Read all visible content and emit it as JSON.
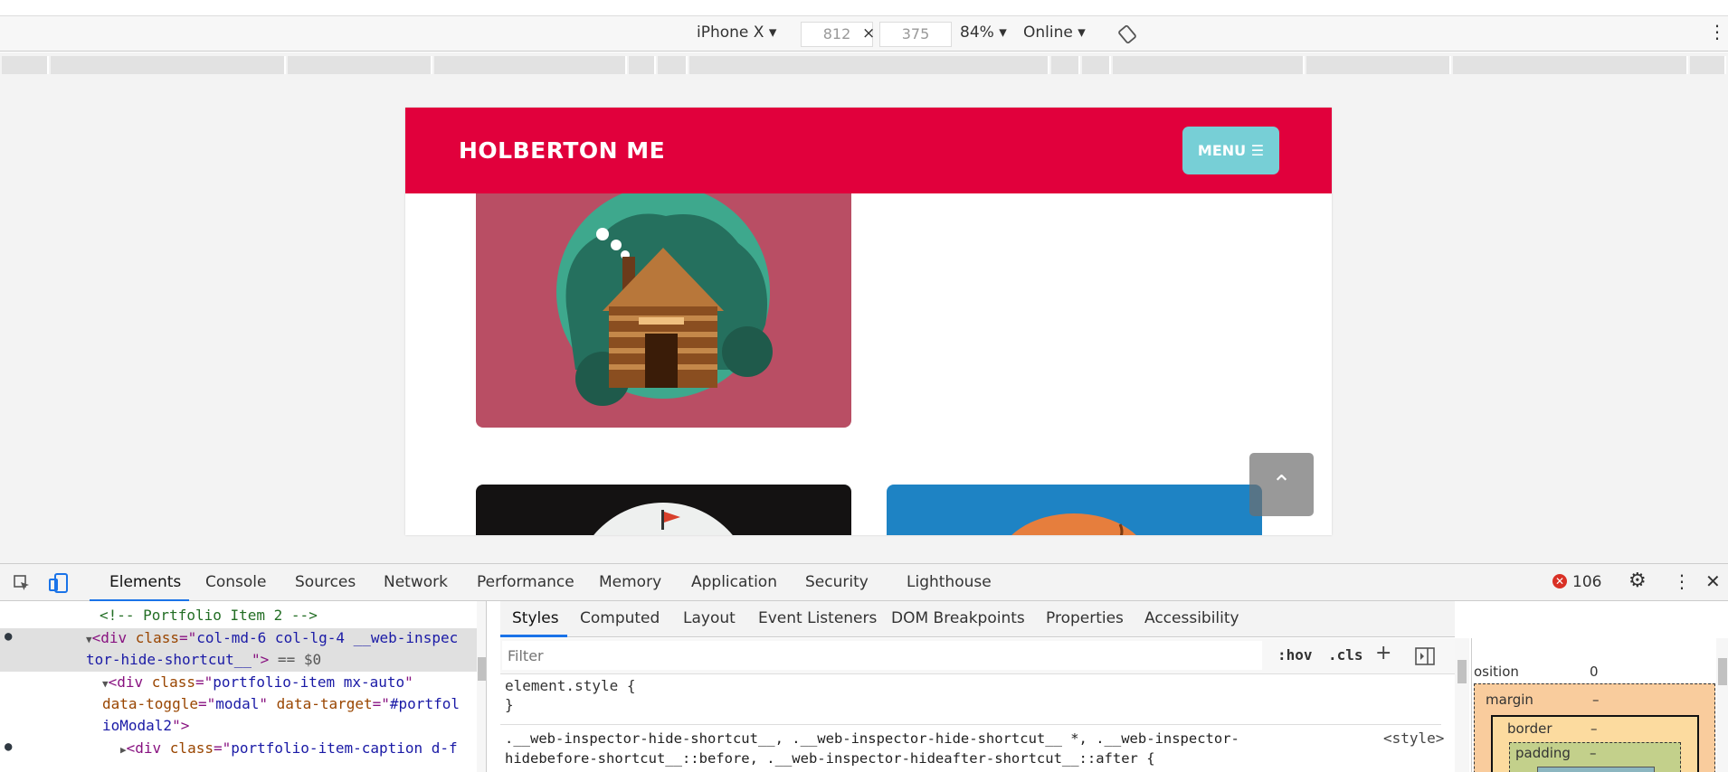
{
  "device_toolbar": {
    "device": "iPhone X",
    "width": "812",
    "x": "×",
    "height": "375",
    "zoom": "84%",
    "throttle": "Online"
  },
  "site": {
    "brand": "HOLBERTON ME",
    "menu_label": "MENU",
    "scroll_top_glyph": "⌃"
  },
  "devtools": {
    "tabs": [
      "Elements",
      "Console",
      "Sources",
      "Network",
      "Performance",
      "Memory",
      "Application",
      "Security",
      "Lighthouse"
    ],
    "error_count": "106",
    "elements_lines": {
      "l1": "<!-- Portfolio Item 2 -->",
      "l2a": "<div ",
      "l2b": "class",
      "l2c": "=\"",
      "l2d": "col-md-6 col-lg-4 __web-inspec",
      "l3a": "tor-hide-shortcut__",
      "l3b": "\">",
      "l3c": " == $0",
      "l4a": "<div ",
      "l4b": "class",
      "l4c": "=\"",
      "l4d": "portfolio-item mx-auto",
      "l4e": "\"",
      "l5a": "data-toggle",
      "l5b": "=\"",
      "l5c": "modal",
      "l5d": "\" ",
      "l5e": "data-target",
      "l5f": "=\"",
      "l5g": "#portfol",
      "l6a": "ioModal2",
      "l6b": "\">",
      "l7a": "<div ",
      "l7b": "class",
      "l7c": "=\"",
      "l7d": "portfolio-item-caption d-f"
    },
    "styles_tabs": [
      "Styles",
      "Computed",
      "Layout",
      "Event Listeners",
      "DOM Breakpoints",
      "Properties",
      "Accessibility"
    ],
    "filter_placeholder": "Filter",
    "hov": ":hov",
    "cls": ".cls",
    "element_style": "element.style {",
    "close_brace": "}",
    "rule_selector_1": ".__web-inspector-hide-shortcut__, .__web-inspector-hide-shortcut__ *, .__web-inspector-",
    "rule_selector_2": "hidebefore-shortcut__::before, .__web-inspector-hideafter-shortcut__::after {",
    "rule_source": "<style>",
    "box": {
      "position_label": "osition",
      "position_value": "0",
      "margin_label": "margin",
      "margin_value": "–",
      "border_label": "border",
      "border_value": "–",
      "padding_label": "padding",
      "padding_value": "–"
    }
  }
}
